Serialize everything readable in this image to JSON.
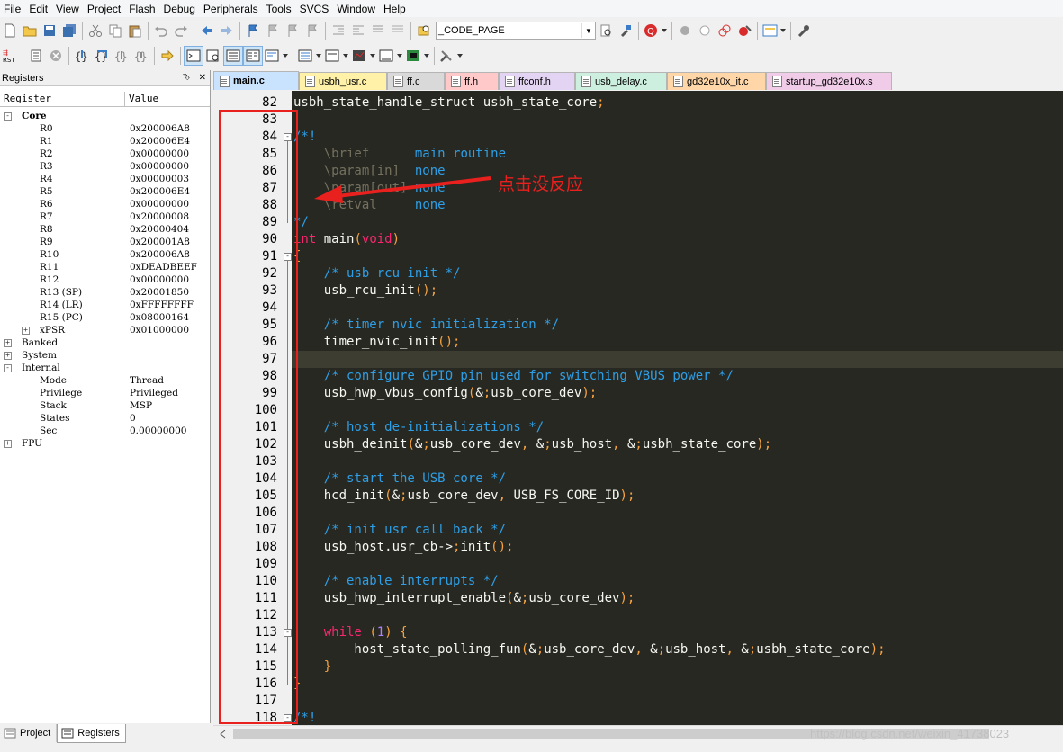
{
  "menu": [
    "File",
    "Edit",
    "View",
    "Project",
    "Flash",
    "Debug",
    "Peripherals",
    "Tools",
    "SVCS",
    "Window",
    "Help"
  ],
  "toolbar": {
    "target_combo": "_CODE_PAGE"
  },
  "panel": {
    "title": "Registers",
    "pin": "⮷",
    "close": "✕",
    "col_register": "Register",
    "col_value": "Value"
  },
  "registers": {
    "core_label": "Core",
    "core": [
      {
        "name": "R0",
        "value": "0x200006A8"
      },
      {
        "name": "R1",
        "value": "0x200006E4"
      },
      {
        "name": "R2",
        "value": "0x00000000"
      },
      {
        "name": "R3",
        "value": "0x00000000"
      },
      {
        "name": "R4",
        "value": "0x00000003"
      },
      {
        "name": "R5",
        "value": "0x200006E4"
      },
      {
        "name": "R6",
        "value": "0x00000000"
      },
      {
        "name": "R7",
        "value": "0x20000008"
      },
      {
        "name": "R8",
        "value": "0x20000404"
      },
      {
        "name": "R9",
        "value": "0x200001A8"
      },
      {
        "name": "R10",
        "value": "0x200006A8"
      },
      {
        "name": "R11",
        "value": "0xDEADBEEF"
      },
      {
        "name": "R12",
        "value": "0x00000000"
      },
      {
        "name": "R13 (SP)",
        "value": "0x20001850"
      },
      {
        "name": "R14 (LR)",
        "value": "0xFFFFFFFF"
      },
      {
        "name": "R15 (PC)",
        "value": "0x08000164"
      },
      {
        "name": "xPSR",
        "value": "0x01000000"
      }
    ],
    "banked_label": "Banked",
    "system_label": "System",
    "internal_label": "Internal",
    "internal": [
      {
        "name": "Mode",
        "value": "Thread"
      },
      {
        "name": "Privilege",
        "value": "Privileged"
      },
      {
        "name": "Stack",
        "value": "MSP"
      },
      {
        "name": "States",
        "value": "0"
      },
      {
        "name": "Sec",
        "value": "0.00000000"
      }
    ],
    "fpu_label": "FPU"
  },
  "bottom_tabs": [
    {
      "label": "Project"
    },
    {
      "label": "Registers"
    }
  ],
  "file_tabs": [
    {
      "label": "main.c",
      "color": "#c9e3ff"
    },
    {
      "label": "usbh_usr.c",
      "color": "#fff2a8"
    },
    {
      "label": "ff.c",
      "color": "#d9d9d9"
    },
    {
      "label": "ff.h",
      "color": "#ffc9c9"
    },
    {
      "label": "ffconf.h",
      "color": "#e4d4f4"
    },
    {
      "label": "usb_delay.c",
      "color": "#cdefdf"
    },
    {
      "label": "gd32e10x_it.c",
      "color": "#ffd6a8"
    },
    {
      "label": "startup_gd32e10x.s",
      "color": "#f0cce8"
    }
  ],
  "code": {
    "current_line": 97,
    "lines": [
      {
        "n": "82",
        "t": "usbh_state_handle_struct usbh_state_core;"
      },
      {
        "n": "83",
        "t": ""
      },
      {
        "n": "84",
        "t": "/*!"
      },
      {
        "n": "85",
        "t": "    \\brief      main routine"
      },
      {
        "n": "86",
        "t": "    \\param[in]  none"
      },
      {
        "n": "87",
        "t": "    \\param[out] none"
      },
      {
        "n": "88",
        "t": "    \\retval     none"
      },
      {
        "n": "89",
        "t": "*/"
      },
      {
        "n": "90",
        "t": "int main(void)"
      },
      {
        "n": "91",
        "t": "{"
      },
      {
        "n": "92",
        "t": "    /* usb rcu init */"
      },
      {
        "n": "93",
        "t": "    usb_rcu_init();"
      },
      {
        "n": "94",
        "t": ""
      },
      {
        "n": "95",
        "t": "    /* timer nvic initialization */"
      },
      {
        "n": "96",
        "t": "    timer_nvic_init();"
      },
      {
        "n": "97",
        "t": ""
      },
      {
        "n": "98",
        "t": "    /* configure GPIO pin used for switching VBUS power */"
      },
      {
        "n": "99",
        "t": "    usb_hwp_vbus_config(&usb_core_dev);"
      },
      {
        "n": "100",
        "t": ""
      },
      {
        "n": "101",
        "t": "    /* host de-initializations */"
      },
      {
        "n": "102",
        "t": "    usbh_deinit(&usb_core_dev, &usb_host, &usbh_state_core);"
      },
      {
        "n": "103",
        "t": ""
      },
      {
        "n": "104",
        "t": "    /* start the USB core */"
      },
      {
        "n": "105",
        "t": "    hcd_init(&usb_core_dev, USB_FS_CORE_ID);"
      },
      {
        "n": "106",
        "t": ""
      },
      {
        "n": "107",
        "t": "    /* init usr call back */"
      },
      {
        "n": "108",
        "t": "    usb_host.usr_cb->init();"
      },
      {
        "n": "109",
        "t": ""
      },
      {
        "n": "110",
        "t": "    /* enable interrupts */"
      },
      {
        "n": "111",
        "t": "    usb_hwp_interrupt_enable(&usb_core_dev);"
      },
      {
        "n": "112",
        "t": ""
      },
      {
        "n": "113",
        "t": "    while (1) {"
      },
      {
        "n": "114",
        "t": "        host_state_polling_fun(&usb_core_dev, &usb_host, &usbh_state_core);"
      },
      {
        "n": "115",
        "t": "    }"
      },
      {
        "n": "116",
        "t": "}"
      },
      {
        "n": "117",
        "t": ""
      },
      {
        "n": "118",
        "t": "/*!"
      }
    ]
  },
  "annotation": "点击没反应",
  "watermark": "https://blog.csdn.net/weixin_41738023",
  "colors": {
    "editor_bg": "#272822",
    "comment": "#2e9fe6",
    "keyword": "#f92672",
    "number": "#ae81ff",
    "text": "#f8f8f2",
    "doc_tag": "#75715e",
    "highlight": "#e8201e"
  }
}
